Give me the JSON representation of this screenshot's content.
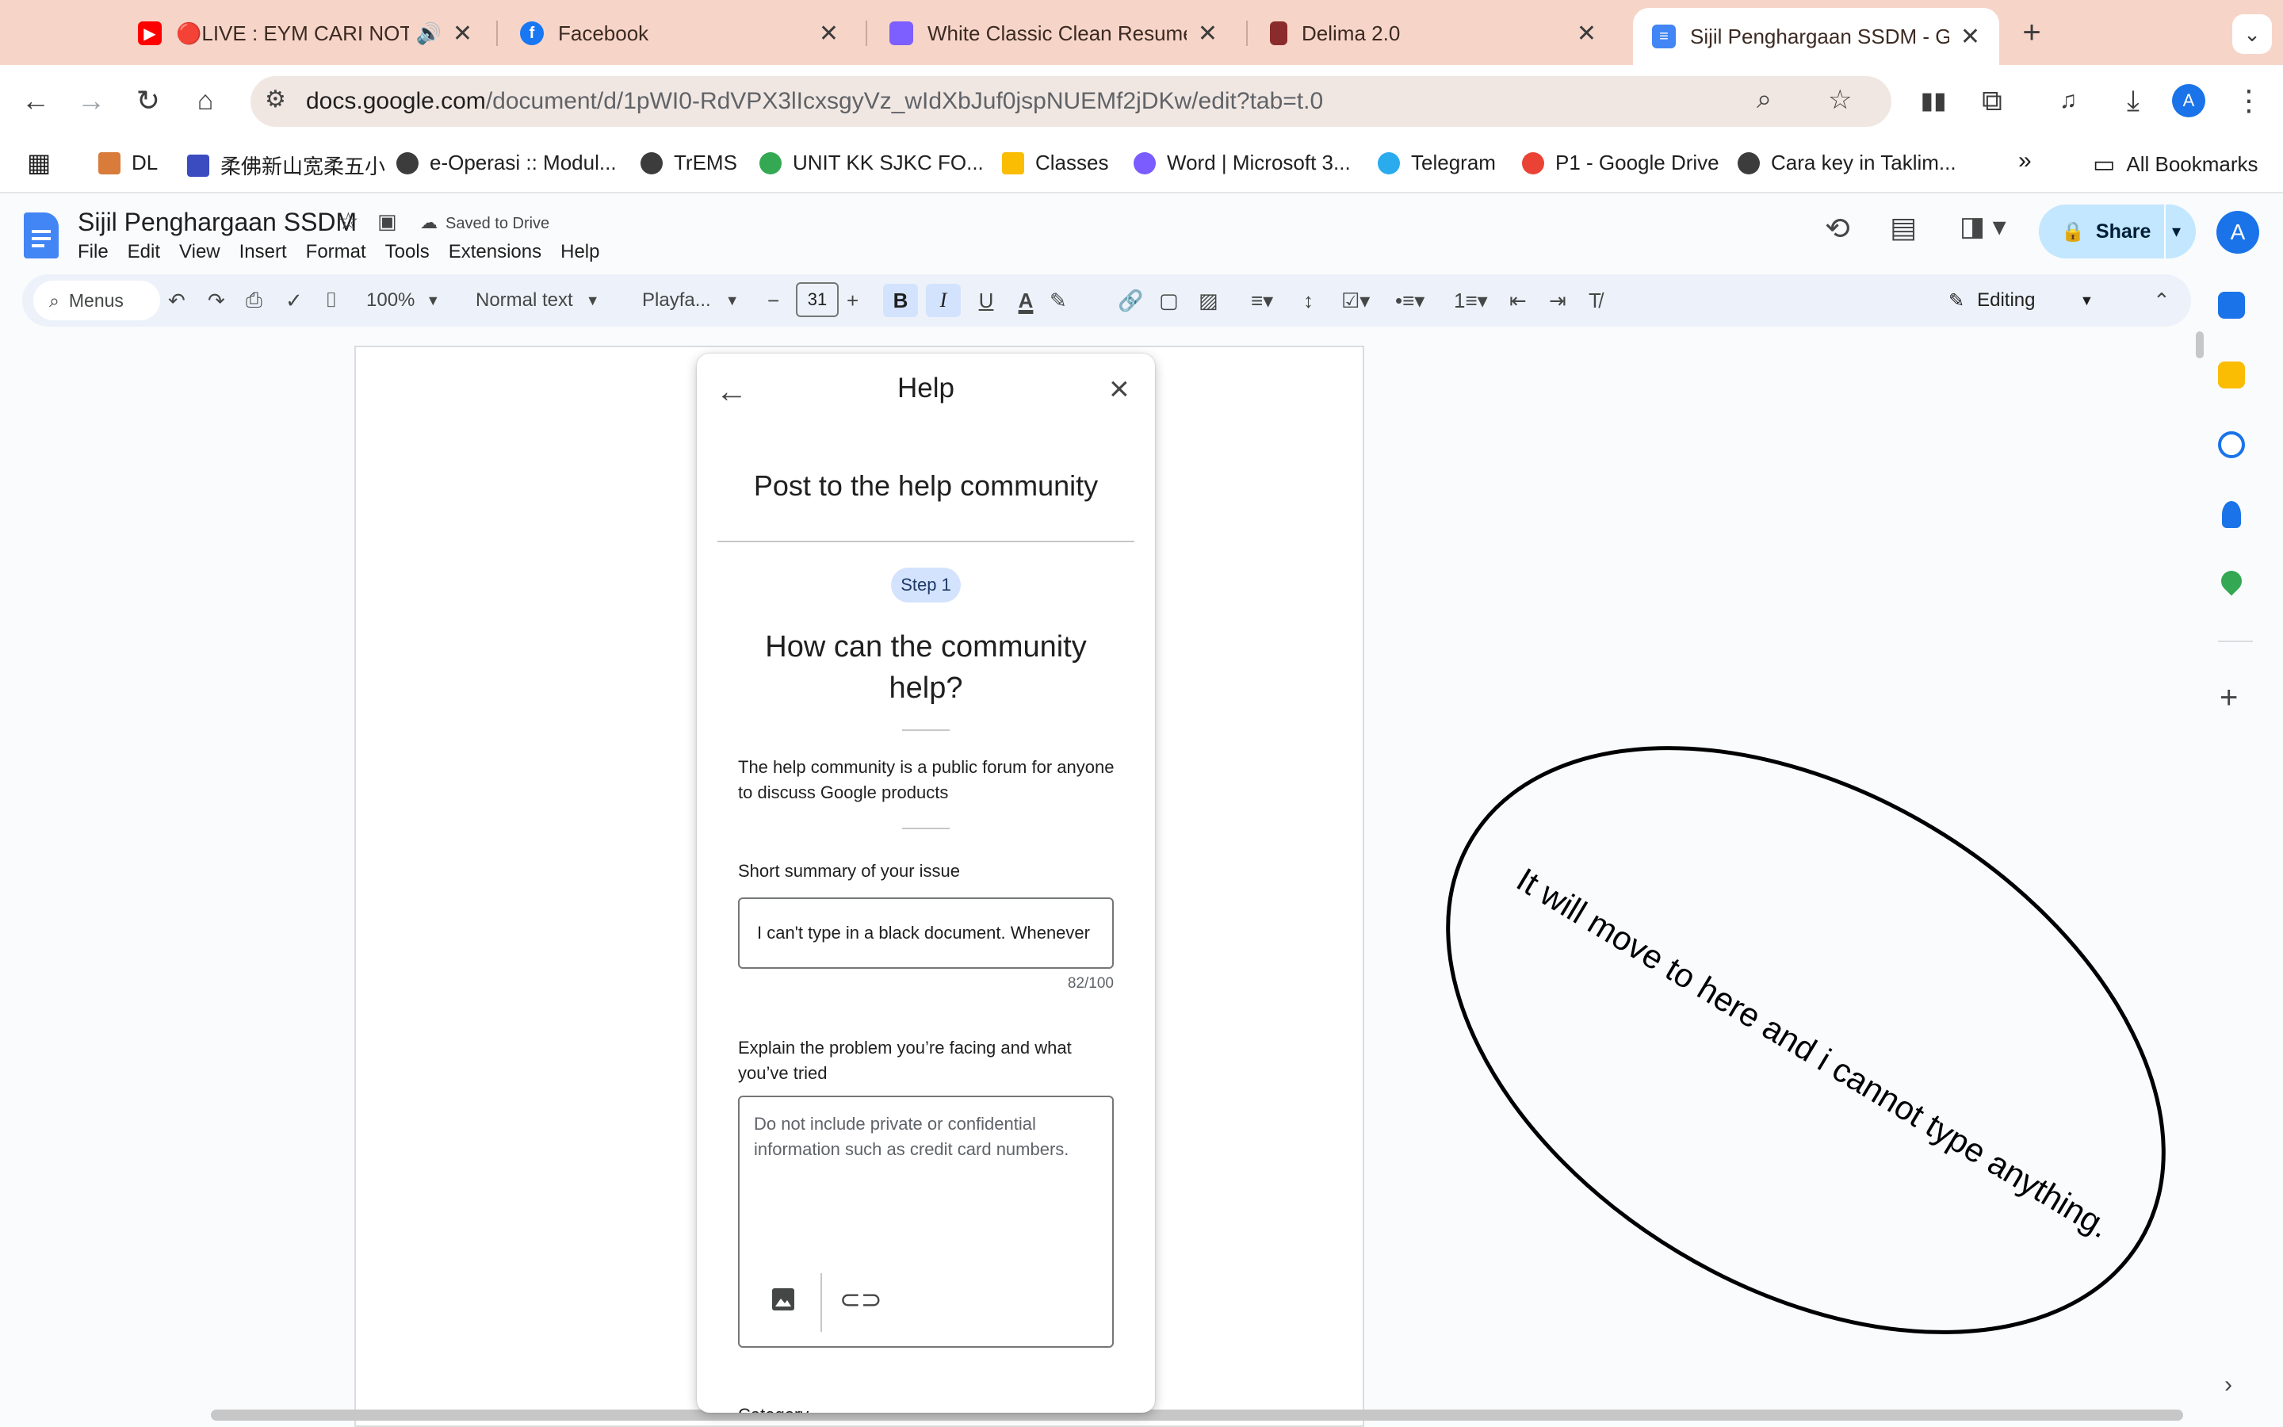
{
  "browser": {
    "tabs": [
      {
        "title": "🔴LIVE : EYM CARI NOTA",
        "favicon": "youtube-icon",
        "color": "#ff0000"
      },
      {
        "title": "Facebook",
        "favicon": "facebook-icon",
        "color": "#1877f2"
      },
      {
        "title": "White Classic Clean Resume",
        "favicon": "canva-icon",
        "color": "#7d5fff"
      },
      {
        "title": "Delima 2.0",
        "favicon": "delima-icon",
        "color": "#8b2c2c"
      },
      {
        "title": "Sijil Penghargaan SSDM - Go",
        "favicon": "docs-icon",
        "color": "#4285f4",
        "active": true
      }
    ],
    "url_host": "docs.google.com",
    "url_path": "/document/d/1pWI0-RdVPX3lIcxsgyVz_wIdXbJuf0jspNUEMf2jDKw/edit?tab=t.0",
    "profile_initial": "A",
    "bookmarks": [
      {
        "label": "DL",
        "color": "#d97b3a"
      },
      {
        "label": "柔佛新山宽柔五小",
        "color": "#3b4cc0"
      },
      {
        "label": "e-Operasi :: Modul...",
        "color": "#3c3c3c"
      },
      {
        "label": "TrEMS",
        "color": "#3c3c3c"
      },
      {
        "label": "UNIT KK SJKC FO...",
        "color": "#34a853"
      },
      {
        "label": "Classes",
        "color": "#fbbc04"
      },
      {
        "label": "Word | Microsoft 3...",
        "color": "#7a5cff"
      },
      {
        "label": "Telegram",
        "color": "#2aabee"
      },
      {
        "label": "P1 - Google Drive",
        "color": "#ea4335"
      },
      {
        "label": "Cara key in Taklim...",
        "color": "#3c3c3c"
      }
    ],
    "all_bookmarks": "All Bookmarks"
  },
  "docs": {
    "title": "Sijil Penghargaan SSDM",
    "saved_status": "Saved to Drive",
    "menu": [
      "File",
      "Edit",
      "View",
      "Insert",
      "Format",
      "Tools",
      "Extensions",
      "Help"
    ],
    "share_label": "Share",
    "avatar_initial": "A",
    "toolbar": {
      "menus_search": "Menus",
      "zoom": "100%",
      "style": "Normal text",
      "font": "Playfa...",
      "font_size": "31",
      "bold": "B",
      "italic": "I",
      "underline": "U",
      "text_color": "A",
      "mode": "Editing"
    }
  },
  "help": {
    "title": "Help",
    "post_title": "Post to the help community",
    "step": "Step 1",
    "question": "How can the community help?",
    "intro": "The help community is a public forum for anyone to discuss Google products",
    "summary_label": "Short summary of your issue",
    "summary_value": "I can't type in a black document. Whenever",
    "summary_count": "82/100",
    "explain_label": "Explain the problem you’re facing and what you’ve tried",
    "explain_placeholder": "Do not include private or confidential information such as credit card numbers.",
    "category_label": "Category"
  },
  "annotation": {
    "text": "It will move to here and i cannot type anything."
  }
}
